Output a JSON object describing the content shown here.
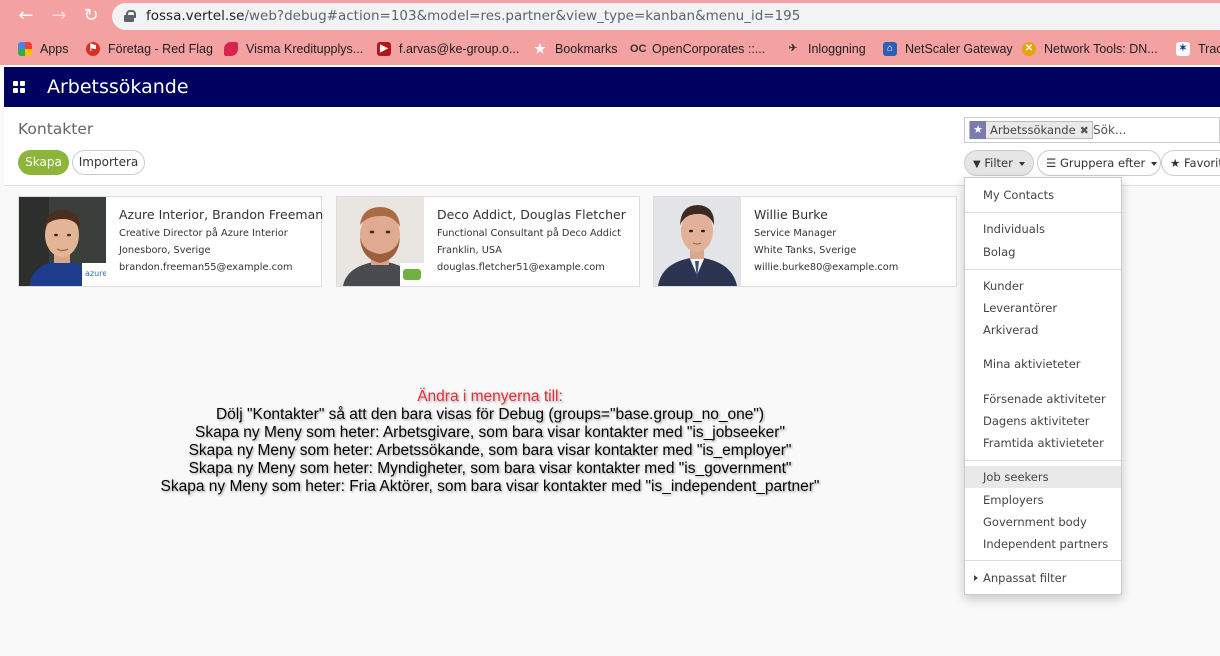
{
  "browser": {
    "url_host": "fossa.vertel.se",
    "url_path": "/web?debug#action=103&model=res.partner&view_type=kanban&menu_id=195",
    "bookmarks": [
      {
        "label": "Apps",
        "icon": "apps-grid-icon",
        "color": "#1a73e8"
      },
      {
        "label": "Företag - Red Flag",
        "icon": "red-flag-icon",
        "color": "#d93025"
      },
      {
        "label": "Visma Kreditupplys...",
        "icon": "visma-icon",
        "color": "#d8234f"
      },
      {
        "label": "f.arvas@ke-group.o...",
        "icon": "mail-icon",
        "color": "#b3141a"
      },
      {
        "label": "Bookmarks",
        "icon": "star-icon",
        "color": "#ffffff"
      },
      {
        "label": "OpenCorporates ::...",
        "icon": "opencorporates-icon",
        "color": "#333333"
      },
      {
        "label": "Inloggning",
        "icon": "bird-icon",
        "color": "#444444"
      },
      {
        "label": "NetScaler Gateway",
        "icon": "gateway-icon",
        "color": "#2f5fb3"
      },
      {
        "label": "Network Tools: DN...",
        "icon": "network-tools-icon",
        "color": "#e8a20c"
      },
      {
        "label": "Trac",
        "icon": "trac-icon",
        "color": "#1a3d8f"
      }
    ]
  },
  "app": {
    "title": "Arbetssökande"
  },
  "control_panel": {
    "breadcrumb": "Kontakter",
    "create_label": "Skapa",
    "import_label": "Importera",
    "search": {
      "facet_label": "Arbetssökande",
      "placeholder": "Sök..."
    },
    "filter_label": "Filter",
    "groupby_label": "Gruppera efter",
    "favorites_label": "Favorit"
  },
  "cards": [
    {
      "name": "Azure Interior, Brandon Freeman",
      "title": "Creative Director på Azure Interior",
      "location": "Jonesboro, Sverige",
      "email": "brandon.freeman55@example.com",
      "badge": "azure"
    },
    {
      "name": "Deco Addict, Douglas Fletcher",
      "title": "Functional Consultant på Deco Addict",
      "location": "Franklin, USA",
      "email": "douglas.fletcher51@example.com",
      "badge": ""
    },
    {
      "name": "Willie Burke",
      "title": "Service Manager",
      "location": "White Tanks, Sverige",
      "email": "willie.burke80@example.com",
      "badge": ""
    }
  ],
  "note": {
    "heading": "Ändra i menyerna till:",
    "lines": [
      "Dölj \"Kontakter\" så att den bara visas för Debug (groups=\"base.group_no_one\")",
      "Skapa ny Meny som heter: Arbetsgivare, som bara visar kontakter med \"is_jobseeker\"",
      "Skapa ny Meny som heter: Arbetssökande, som bara visar kontakter med \"is_employer\"",
      "Skapa ny Meny som heter: Myndigheter, som bara visar kontakter med \"is_government\"",
      "Skapa ny Meny som heter: Fria Aktörer, som bara visar kontakter med \"is_independent_partner\""
    ]
  },
  "filter_menu": {
    "items": [
      "My Contacts",
      "Individuals",
      "Bolag",
      "Kunder",
      "Leverantörer",
      "Arkiverad",
      "Mina aktivieteter",
      "Försenade aktiviteter",
      "Dagens aktiviteter",
      "Framtida aktivieteter",
      "Job seekers",
      "Employers",
      "Government body",
      "Independent partners",
      "Anpassat filter"
    ],
    "selected": "Job seekers"
  },
  "colors": {
    "navbar": "#000060",
    "primary_button": "#8eb53a",
    "browser_chrome": "#f4a1a1",
    "facet_icon": "#7c7bad",
    "note_heading": "#e0303a"
  }
}
